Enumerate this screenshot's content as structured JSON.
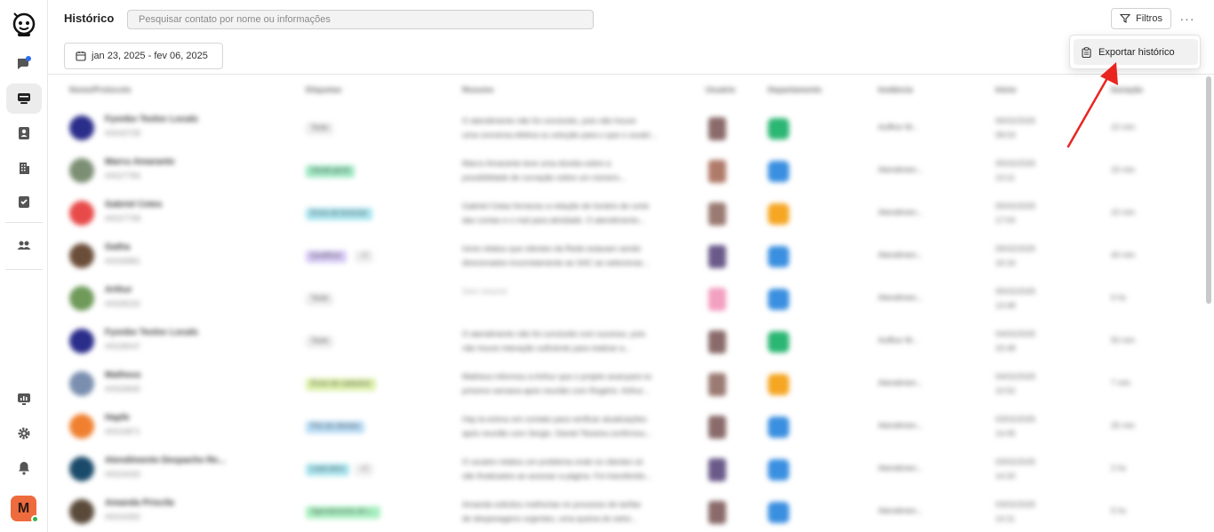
{
  "header": {
    "title": "Histórico",
    "search_placeholder": "Pesquisar contato por nome ou informações",
    "filters_label": "Filtros",
    "more_label": "···",
    "date_range": "jan 23, 2025 - fev 06, 2025"
  },
  "menu": {
    "export_label": "Exportar histórico"
  },
  "sidebar": {
    "user_initial": "M",
    "items": [
      "chat-icon",
      "inbox-icon",
      "contacts-icon",
      "building-icon",
      "tasks-icon",
      "team-icon",
      "reports-icon",
      "settings-icon",
      "bell-icon"
    ]
  },
  "table": {
    "columns": [
      "Nome/Protocolo",
      "Etiquetas",
      "Resumo",
      "Usuário",
      "Departamento",
      "Instância",
      "Início",
      "Duração"
    ],
    "rows": [
      {
        "name": "Fyonbo Teoloc Locals",
        "proto": "#0043728",
        "tag": "Teste",
        "tag_color": "#ececec",
        "tag2": "",
        "resumo": [
          "O atendimento não foi concluído, pois não houve",
          "uma conversa efetiva ou solução para o que o usuári..."
        ],
        "avatar": "#2a2d8a",
        "user": "#8a6a6a",
        "dept": "#2bb673",
        "inst": "Auffice W...",
        "inicio": [
          "06/02/2025",
          "08:03"
        ],
        "dur": "10 min"
      },
      {
        "name": "Marcu Amaranto",
        "proto": "#0027784",
        "tag": "Venda geral",
        "tag_color": "#9fe8c3",
        "tag2": "",
        "resumo": [
          "Marco Amarante teve uma dúvida sobre a",
          "possibilidade de curvação sobre um número..."
        ],
        "avatar": "#7c8f74",
        "user": "#b07a6a",
        "dept": "#3a8fe0",
        "inst": "Atendimen...",
        "inicio": [
          "05/02/2025",
          "13:11"
        ],
        "dur": "15 min"
      },
      {
        "name": "Gabriel Cetes",
        "proto": "#0027708",
        "tag": "Envio de licenciar",
        "tag_color": "#a8e4ee",
        "tag2": "",
        "resumo": [
          "Gabriel Cetas forneceu a relação de horário de corte",
          "das contas e o mal para atividade. O atendimento..."
        ],
        "avatar": "#e84a4a",
        "user": "#9a7a72",
        "dept": "#f5a623",
        "inst": "Atendimen...",
        "inicio": [
          "05/02/2025",
          "17:00"
        ],
        "dur": "10 min"
      },
      {
        "name": "Gatha",
        "proto": "#0026881",
        "tag": "Qualificar",
        "tag_color": "#d6c8f5",
        "tag2": "+2",
        "resumo": [
          "Irene relatou que clientes da Rede estavam sendo",
          "direcionados incorretamente ao SAC ao selecionar..."
        ],
        "avatar": "#6b4e3a",
        "user": "#6a5a8a",
        "dept": "#3a8fe0",
        "inst": "Atendimen...",
        "inicio": [
          "05/02/2025",
          "16:16"
        ],
        "dur": "40 min"
      },
      {
        "name": "Arthur",
        "proto": "#0028192",
        "tag": "Teste",
        "tag_color": "#ececec",
        "tag2": "",
        "resumo": [
          "Sem resumo",
          ""
        ],
        "avatar": "#6f9a5a",
        "user": "#f2a0c0",
        "dept": "#3a8fe0",
        "inst": "Atendimen...",
        "inicio": [
          "05/02/2025",
          "13:48"
        ],
        "dur": "5 hs"
      },
      {
        "name": "Fyonbo Teoloc Locals",
        "proto": "#0028047",
        "tag": "Teste",
        "tag_color": "#ececec",
        "tag2": "",
        "resumo": [
          "O atendimento não foi concluído com sucesso, pois",
          "não houve interação suficiente para realizar a..."
        ],
        "avatar": "#2a2d8a",
        "user": "#8a6a6a",
        "dept": "#2bb673",
        "inst": "Auffice W...",
        "inicio": [
          "04/02/2025",
          "15:48"
        ],
        "dur": "50 min"
      },
      {
        "name": "Matheus",
        "proto": "#0026845",
        "tag": "Envio de cadastrar",
        "tag_color": "#dcf0a8",
        "tag2": "",
        "resumo": [
          "Matheus informou a Arthur que o projeto avançará no",
          "próximo semana após reunião com Rogério. Arthur..."
        ],
        "avatar": "#7a8fb0",
        "user": "#9a7a72",
        "dept": "#f5a623",
        "inst": "Atendimen...",
        "inicio": [
          "04/02/2025",
          "10:52"
        ],
        "dur": "7 min"
      },
      {
        "name": "Hapfe",
        "proto": "#0024871",
        "tag": "Pós de clientes",
        "tag_color": "#b8dcf5",
        "tag2": "",
        "resumo": [
          "Hay la entrou em contato para verificar atualizações",
          "após reunião com Sergio. Daniel Teixeira confirmou..."
        ],
        "avatar": "#f08030",
        "user": "#8a6a6a",
        "dept": "#3a8fe0",
        "inst": "Atendimen...",
        "inicio": [
          "03/02/2025",
          "14:45"
        ],
        "dur": "25 min"
      },
      {
        "name": "Atendimento Despacho Re...",
        "proto": "#0024430",
        "tag": "Lead ativo",
        "tag_color": "#a8e4ee",
        "tag2": "+2",
        "resumo": [
          "O usuário relatou um problema onde os clientes só",
          "são finalizados ao acessar a página. Foi transferido..."
        ],
        "avatar": "#1a4a6a",
        "user": "#6a5a8a",
        "dept": "#3a8fe0",
        "inst": "Atendimen...",
        "inicio": [
          "03/02/2025",
          "14:20"
        ],
        "dur": "2 hs"
      },
      {
        "name": "Amanda Priscila",
        "proto": "#0024392",
        "tag": "Agendamento de r...",
        "tag_color": "#a8f0c0",
        "tag2": "",
        "resumo": [
          "Amanda solicitou melhorias no processo de tarifas",
          "de despesagens urgentes, uma queixa do setor..."
        ],
        "avatar": "#5a4a3a",
        "user": "#8a6a6a",
        "dept": "#3a8fe0",
        "inst": "Atendimen...",
        "inicio": [
          "03/02/2025",
          "14:11"
        ],
        "dur": "5 hs"
      }
    ]
  }
}
